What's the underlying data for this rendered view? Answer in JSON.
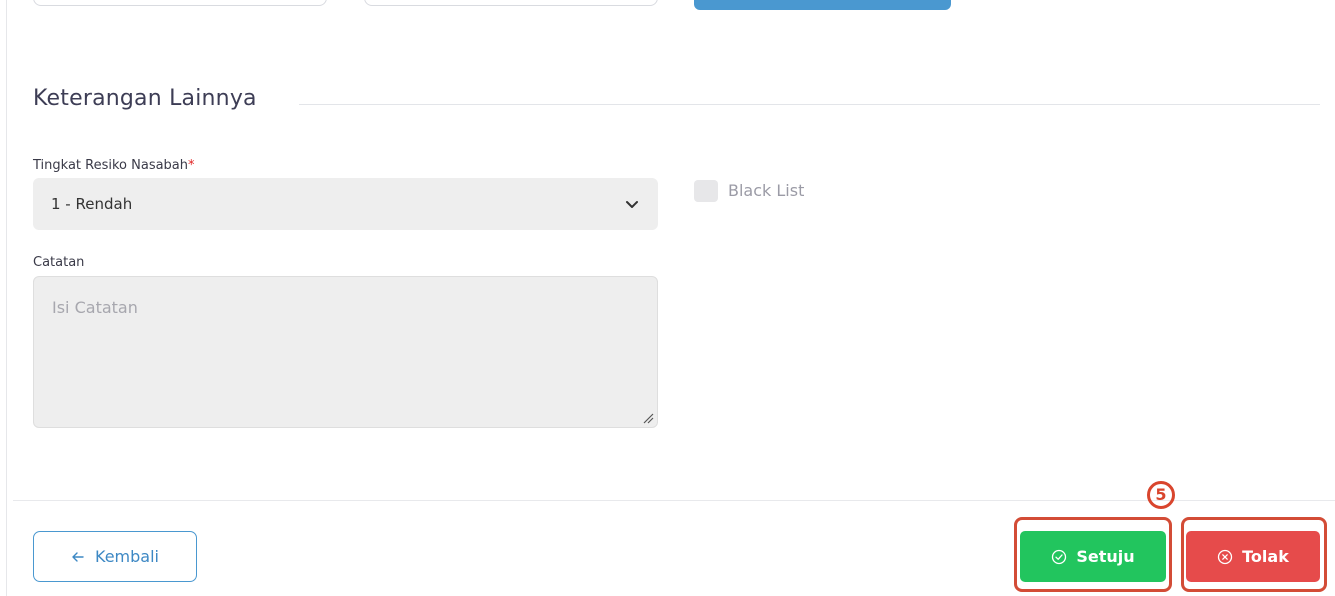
{
  "section": {
    "title": "Keterangan Lainnya"
  },
  "risk": {
    "label": "Tingkat Resiko Nasabah",
    "required_mark": "*",
    "value": "1 - Rendah"
  },
  "blacklist": {
    "label": "Black List",
    "checked": false
  },
  "note": {
    "label": "Catatan",
    "placeholder": "Isi Catatan",
    "value": ""
  },
  "footer": {
    "back_label": "Kembali",
    "approve_label": "Setuju",
    "reject_label": "Tolak",
    "step_badge": "5"
  },
  "colors": {
    "primary": "#4a98d0",
    "approve": "#22c55e",
    "reject": "#e64b4b",
    "highlight": "#d34c36"
  },
  "icons": {
    "back": "arrow-left-icon",
    "approve": "check-circle-icon",
    "reject": "x-circle-icon",
    "select": "chevron-down-icon"
  }
}
